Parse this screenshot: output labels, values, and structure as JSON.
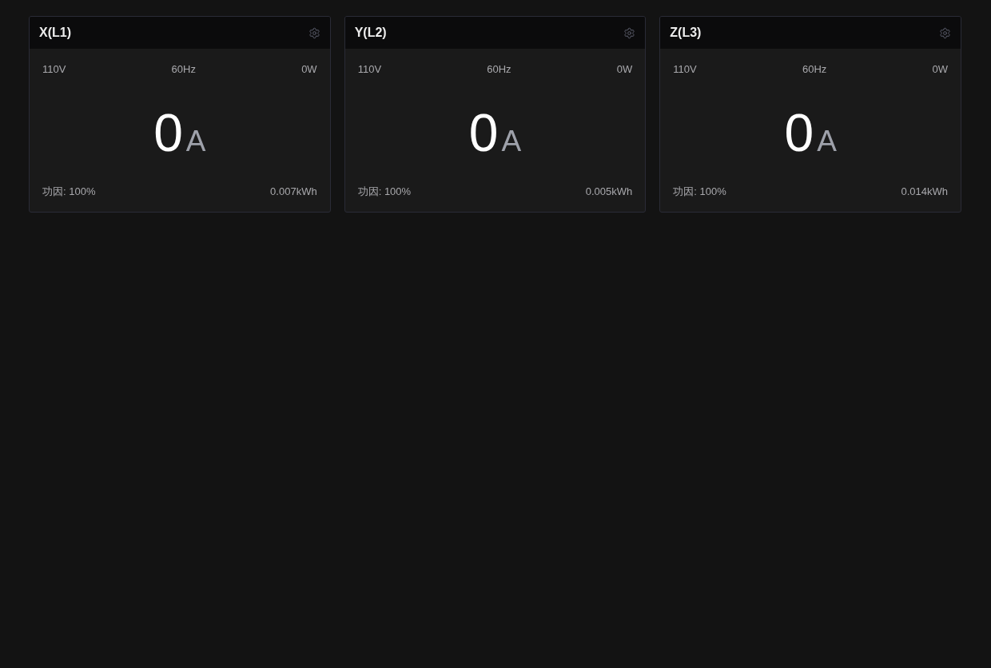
{
  "panels": [
    {
      "title": "X(L1)",
      "voltage": "110V",
      "frequency": "60Hz",
      "power": "0W",
      "current": {
        "value": "0",
        "unit": "A"
      },
      "power_factor": "功因: 100%",
      "energy": "0.007kWh"
    },
    {
      "title": "Y(L2)",
      "voltage": "110V",
      "frequency": "60Hz",
      "power": "0W",
      "current": {
        "value": "0",
        "unit": "A"
      },
      "power_factor": "功因: 100%",
      "energy": "0.005kWh"
    },
    {
      "title": "Z(L3)",
      "voltage": "110V",
      "frequency": "60Hz",
      "power": "0W",
      "current": {
        "value": "0",
        "unit": "A"
      },
      "power_factor": "功因: 100%",
      "energy": "0.014kWh"
    }
  ]
}
